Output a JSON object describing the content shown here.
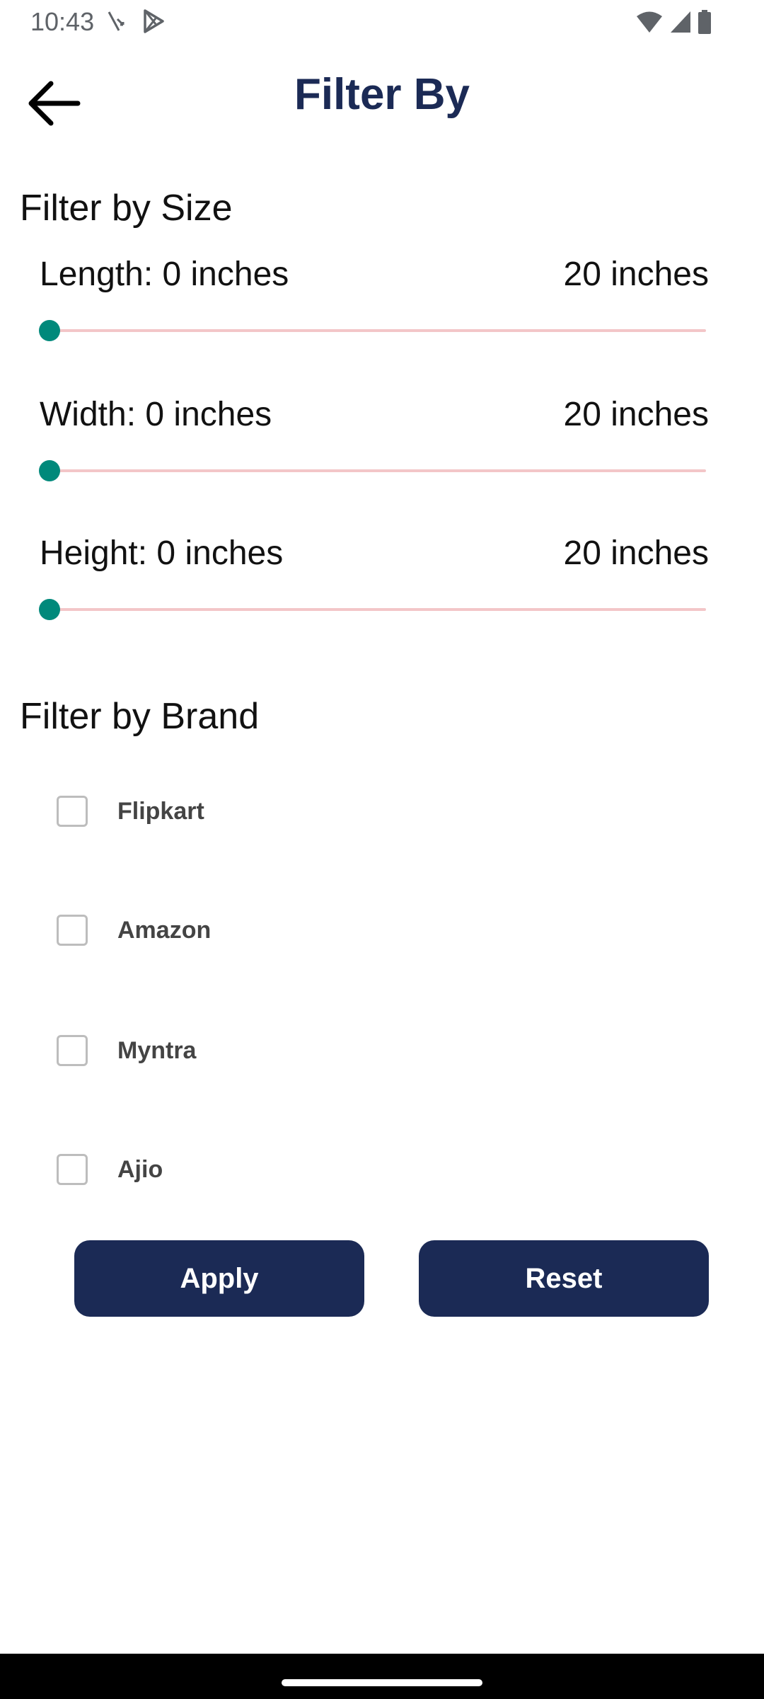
{
  "status_bar": {
    "time": "10:43",
    "icons_left": [
      "missed-call-icon",
      "play-store-icon"
    ],
    "icons_right": [
      "wifi-icon",
      "signal-icon",
      "battery-icon"
    ]
  },
  "header": {
    "back_icon": "arrow-left-icon",
    "title": "Filter By"
  },
  "size_section": {
    "title": "Filter by Size",
    "filters": [
      {
        "label": "Length: 0 inches",
        "max_label": "20 inches",
        "value": 0,
        "min": 0,
        "max": 20
      },
      {
        "label": "Width: 0 inches",
        "max_label": "20 inches",
        "value": 0,
        "min": 0,
        "max": 20
      },
      {
        "label": "Height: 0 inches",
        "max_label": "20 inches",
        "value": 0,
        "min": 0,
        "max": 20
      }
    ]
  },
  "brand_section": {
    "title": "Filter by Brand",
    "brands": [
      {
        "label": "Flipkart",
        "checked": false
      },
      {
        "label": "Amazon",
        "checked": false
      },
      {
        "label": "Myntra",
        "checked": false
      },
      {
        "label": "Ajio",
        "checked": false
      }
    ]
  },
  "actions": {
    "apply_label": "Apply",
    "reset_label": "Reset"
  },
  "colors": {
    "primary": "#1b2a55",
    "slider_thumb": "#00897b",
    "slider_track": "#f3c6c8"
  }
}
